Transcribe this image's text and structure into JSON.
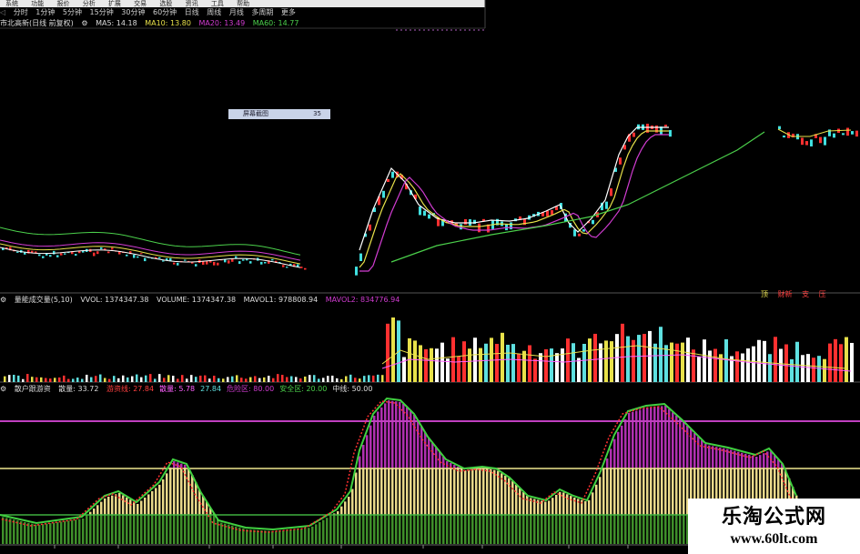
{
  "menu": [
    "系统",
    "功能",
    "报价",
    "分析",
    "扩展",
    "交易",
    "选股",
    "资讯",
    "工具",
    "帮助"
  ],
  "toolbar": {
    "back": "◁",
    "periods": [
      "分时",
      "1分钟",
      "5分钟",
      "15分钟",
      "30分钟",
      "60分钟",
      "日线",
      "周线",
      "月线",
      "多周期",
      "更多"
    ]
  },
  "main_indicator": {
    "title": "市北高新(日线 前复权)",
    "ma5": "MA5: 14.18",
    "ma10": "MA10: 13.80",
    "ma20": "MA20: 13.49",
    "ma60": "MA60: 14.77"
  },
  "popup": {
    "label": "屏幕截图",
    "value": "35"
  },
  "price_labels": [
    "顶",
    "财新",
    "支",
    "压"
  ],
  "volume_indicator": {
    "title": "量能成交量(5,10)",
    "vvol": "VVOL: 1374347.38",
    "volume": "VOLUME: 1374347.38",
    "mavol1": "MAVOL1: 978808.94",
    "mavol2": "MAVOL2: 834776.94"
  },
  "bottom_indicator": {
    "title": "散户跟游资",
    "value": "散量: 33.72",
    "items": [
      {
        "text": "游资线: 27.84",
        "color": "#ff4040"
      },
      {
        "text": "散量: 5.78",
        "color": "#ff60ff"
      },
      {
        "text": "27.84",
        "color": "#5ee0e0"
      },
      {
        "text": "危险区: 80.00",
        "color": "#d13cd1"
      },
      {
        "text": "安全区: 20.00",
        "color": "#4bd04b"
      },
      {
        "text": "中线: 50.00",
        "color": "#dddddd"
      }
    ]
  },
  "colors": {
    "up": "#ff3030",
    "down": "#40e0e0",
    "ma5": "#ffffff",
    "ma10": "#e8e14a",
    "ma20": "#d13cd1",
    "ma60": "#4bd04b"
  },
  "watermark": {
    "title": "乐淘公式网",
    "url": "www.60lt.com"
  }
}
